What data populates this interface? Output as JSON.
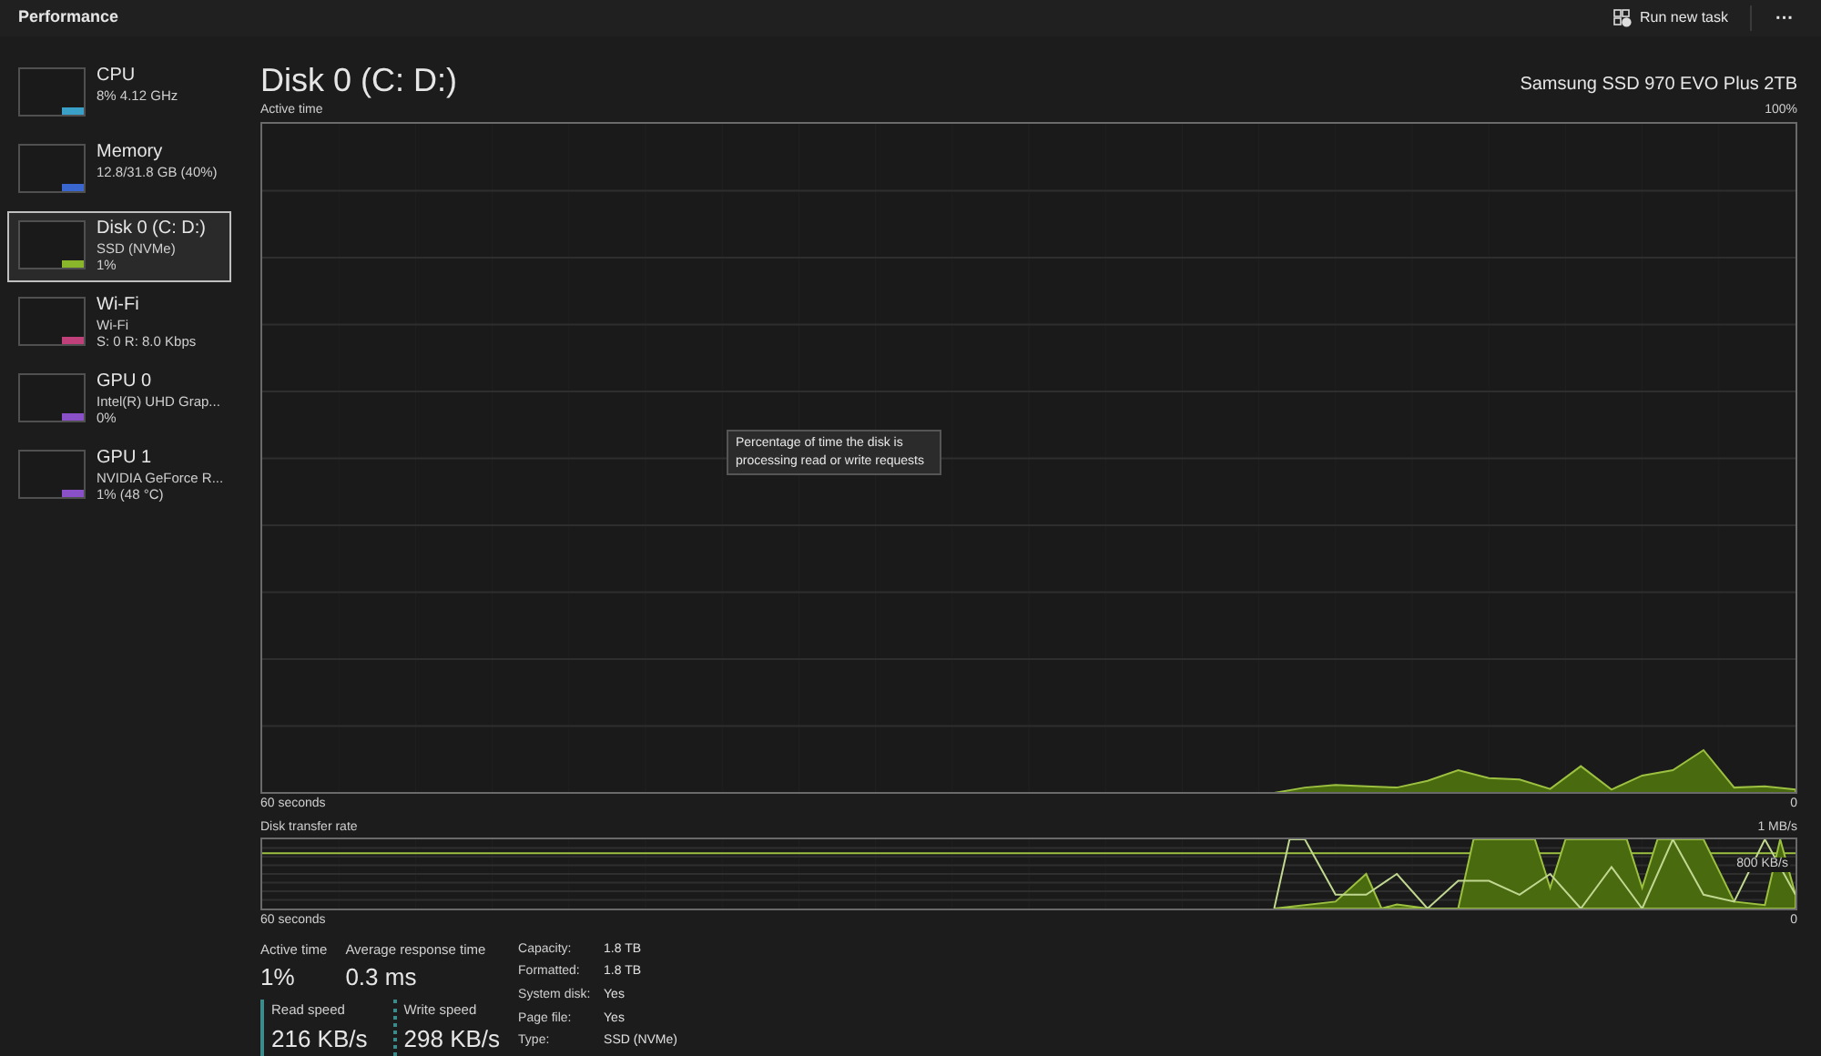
{
  "header": {
    "title": "Performance",
    "run_task": "Run new task",
    "more": "···"
  },
  "sidebar": {
    "items": [
      {
        "name": "CPU",
        "lines": [
          "8% 4.12 GHz"
        ],
        "color": "#3aa0c8",
        "selected": false
      },
      {
        "name": "Memory",
        "lines": [
          "12.8/31.8 GB (40%)"
        ],
        "color": "#3a66d0",
        "selected": false
      },
      {
        "name": "Disk 0 (C: D:)",
        "lines": [
          "SSD (NVMe)",
          "1%"
        ],
        "color": "#8ab62c",
        "selected": true
      },
      {
        "name": "Wi-Fi",
        "lines": [
          "Wi-Fi",
          "S: 0 R: 8.0 Kbps"
        ],
        "color": "#c0407a",
        "selected": false
      },
      {
        "name": "GPU 0",
        "lines": [
          "Intel(R) UHD Grap...",
          "0%"
        ],
        "color": "#8a50c8",
        "selected": false
      },
      {
        "name": "GPU 1",
        "lines": [
          "NVIDIA GeForce R...",
          "1% (48 °C)"
        ],
        "color": "#8a50c8",
        "selected": false
      }
    ]
  },
  "main": {
    "title": "Disk 0 (C: D:)",
    "model": "Samsung SSD 970 EVO Plus 2TB",
    "graph1": {
      "label": "Active time",
      "max": "100%",
      "time": "60 seconds",
      "min": "0"
    },
    "tooltip": "Percentage of time the disk is processing read or write requests",
    "graph2": {
      "label": "Disk transfer rate",
      "max": "1 MB/s",
      "mid": "800 KB/s",
      "time": "60 seconds",
      "min": "0"
    },
    "stats": [
      {
        "label": "Active time",
        "value": "1%"
      },
      {
        "label": "Average response time",
        "value": "0.3 ms"
      }
    ],
    "speeds": [
      {
        "label": "Read speed",
        "value": "216 KB/s",
        "color": "#3c8a8a"
      },
      {
        "label": "Write speed",
        "value": "298 KB/s",
        "color": "#3c8a8a"
      }
    ],
    "properties": [
      {
        "key": "Capacity:",
        "value": "1.8 TB"
      },
      {
        "key": "Formatted:",
        "value": "1.8 TB"
      },
      {
        "key": "System disk:",
        "value": "Yes"
      },
      {
        "key": "Page file:",
        "value": "Yes"
      },
      {
        "key": "Type:",
        "value": "SSD (NVMe)"
      }
    ]
  }
}
